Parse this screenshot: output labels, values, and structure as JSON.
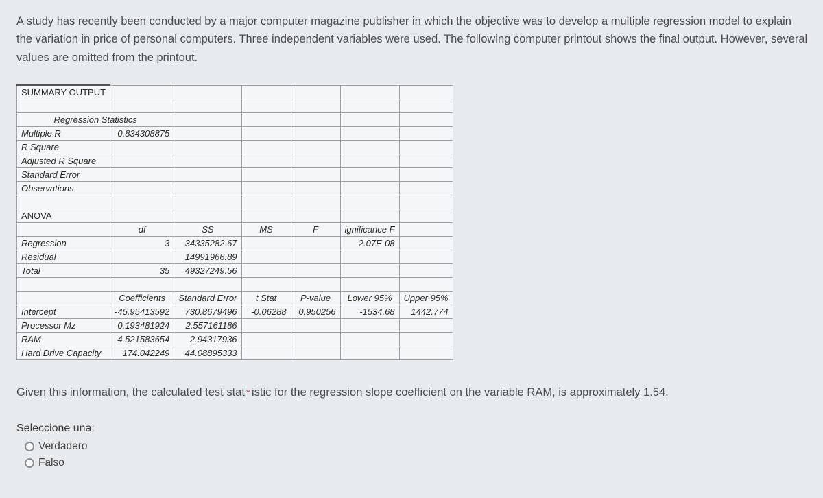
{
  "prompt": "A study has recently been conducted by a major computer magazine publisher in which the objective was to develop a multiple regression model to explain the variation in price of personal computers. Three independent variables were used. The following computer printout shows the final output. However, several values are omitted from the printout.",
  "summary": {
    "title": "SUMMARY OUTPUT",
    "reg_stats_title": "Regression Statistics",
    "rows": {
      "multiple_r": {
        "label": "Multiple R",
        "value": "0.834308875"
      },
      "r_square": {
        "label": "R Square",
        "value": ""
      },
      "adj_r_square": {
        "label": "Adjusted R Square",
        "value": ""
      },
      "standard_error": {
        "label": "Standard Error",
        "value": ""
      },
      "observations": {
        "label": "Observations",
        "value": ""
      }
    }
  },
  "anova": {
    "title": "ANOVA",
    "headers": {
      "df": "df",
      "ss": "SS",
      "ms": "MS",
      "f": "F",
      "sigf": "ignificance F"
    },
    "rows": {
      "regression": {
        "label": "Regression",
        "df": "3",
        "ss": "34335282.67",
        "ms": "",
        "f": "",
        "sigf": "2.07E-08"
      },
      "residual": {
        "label": "Residual",
        "df": "",
        "ss": "14991966.89",
        "ms": "",
        "f": "",
        "sigf": ""
      },
      "total": {
        "label": "Total",
        "df": "35",
        "ss": "49327249.56",
        "ms": "",
        "f": "",
        "sigf": ""
      }
    }
  },
  "coef": {
    "headers": {
      "coef": "Coefficients",
      "se": "Standard Error",
      "t": "t Stat",
      "p": "P-value",
      "lo95": "Lower 95%",
      "up95": "Upper 95%"
    },
    "rows": {
      "intercept": {
        "label": "Intercept",
        "coef": "-45.95413592",
        "se": "730.8679496",
        "t": "-0.06288",
        "p": "0.950256",
        "lo95": "-1534.68",
        "up95": "1442.774"
      },
      "proc": {
        "label": "Processor Mz",
        "coef": "0.193481924",
        "se": "2.557161186",
        "t": "",
        "p": "",
        "lo95": "",
        "up95": ""
      },
      "ram": {
        "label": "RAM",
        "coef": "4.521583654",
        "se": "2.94317936",
        "t": "",
        "p": "",
        "lo95": "",
        "up95": ""
      },
      "hdd": {
        "label": "Hard Drive Capacity",
        "coef": "174.042249",
        "se": "44.08895333",
        "t": "",
        "p": "",
        "lo95": "",
        "up95": ""
      }
    }
  },
  "claim_prefix": "Given this information, the calculated test stat",
  "claim_mid": "i",
  "claim_suffix": "stic for the regression slope coefficient on the variable RAM, is approximately 1.54.",
  "answers": {
    "title": "Seleccione una:",
    "opt_true": "Verdadero",
    "opt_false": "Falso"
  }
}
